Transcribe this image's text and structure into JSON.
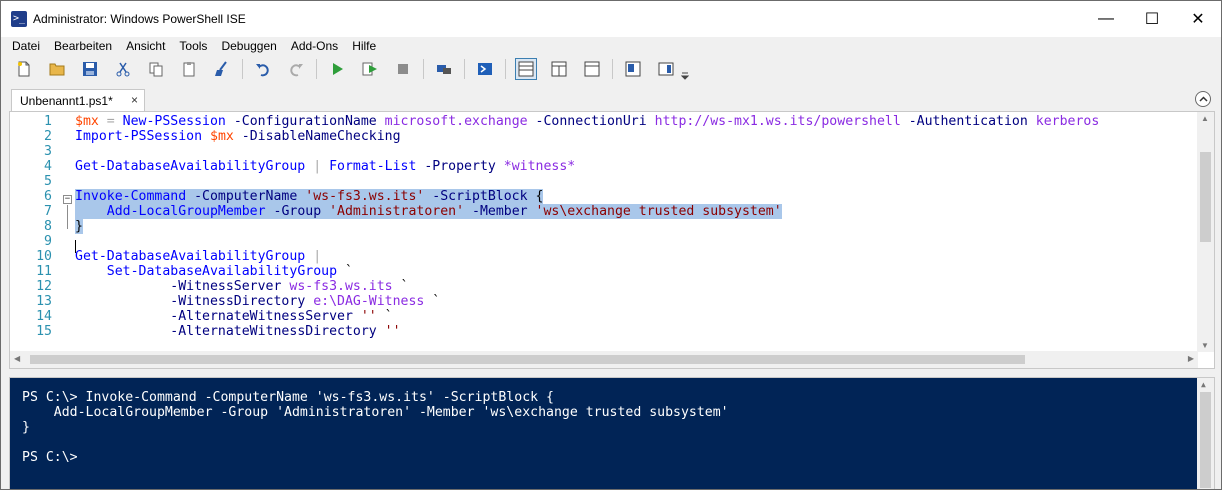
{
  "window": {
    "title": "Administrator: Windows PowerShell ISE",
    "app_icon_glyph": ">_",
    "controls": {
      "minimize": "—",
      "maximize": "☐",
      "close": "✕"
    }
  },
  "menu": [
    "Datei",
    "Bearbeiten",
    "Ansicht",
    "Tools",
    "Debuggen",
    "Add-Ons",
    "Hilfe"
  ],
  "toolbar": {
    "buttons": [
      "new-file",
      "open-file",
      "save",
      "cut",
      "copy",
      "paste",
      "clear-console",
      "undo",
      "redo",
      "run-script",
      "run-selection",
      "stop",
      "new-remote-tab",
      "start-powershell",
      "layout-top",
      "layout-right",
      "layout-max",
      "show-script-pane",
      "show-commands",
      "more"
    ],
    "active": "layout-top"
  },
  "tab": {
    "label": "Unbenannt1.ps1*",
    "close": "×"
  },
  "editor": {
    "lines": [
      {
        "n": "1",
        "tokens": [
          {
            "t": "$mx",
            "c": "var"
          },
          {
            "t": " = ",
            "c": "op"
          },
          {
            "t": "New-PSSession",
            "c": "cmd"
          },
          {
            "t": " -ConfigurationName ",
            "c": "param"
          },
          {
            "t": "microsoft.exchange",
            "c": "arg"
          },
          {
            "t": " -ConnectionUri ",
            "c": "param"
          },
          {
            "t": "http://ws-mx1.ws.its/powershell",
            "c": "arg"
          },
          {
            "t": " -Authentication ",
            "c": "param"
          },
          {
            "t": "kerberos",
            "c": "arg"
          }
        ]
      },
      {
        "n": "2",
        "tokens": [
          {
            "t": "Import-PSSession",
            "c": "cmd"
          },
          {
            "t": " ",
            "c": "grp"
          },
          {
            "t": "$mx",
            "c": "var"
          },
          {
            "t": " -DisableNameChecking",
            "c": "param"
          }
        ]
      },
      {
        "n": "3",
        "tokens": []
      },
      {
        "n": "4",
        "tokens": [
          {
            "t": "Get-DatabaseAvailabilityGroup",
            "c": "cmd"
          },
          {
            "t": " | ",
            "c": "op"
          },
          {
            "t": "Format-List",
            "c": "cmd"
          },
          {
            "t": " -Property ",
            "c": "param"
          },
          {
            "t": "*witness*",
            "c": "arg"
          }
        ]
      },
      {
        "n": "5",
        "tokens": []
      },
      {
        "n": "6",
        "tokens": [
          {
            "t": "Invoke-Command",
            "c": "cmd"
          },
          {
            "t": " -ComputerName ",
            "c": "param"
          },
          {
            "t": "'ws-fs3.ws.its'",
            "c": "str"
          },
          {
            "t": " -ScriptBlock ",
            "c": "param"
          },
          {
            "t": "{",
            "c": "grp"
          }
        ],
        "selected": true
      },
      {
        "n": "7",
        "tokens": [
          {
            "t": "    ",
            "c": "grp"
          },
          {
            "t": "Add-LocalGroupMember",
            "c": "cmd"
          },
          {
            "t": " -Group ",
            "c": "param"
          },
          {
            "t": "'Administratoren'",
            "c": "str"
          },
          {
            "t": " -Member ",
            "c": "param"
          },
          {
            "t": "'ws\\exchange trusted subsystem'",
            "c": "str"
          }
        ],
        "selected": true
      },
      {
        "n": "8",
        "tokens": [
          {
            "t": "}",
            "c": "grp"
          }
        ],
        "selected": true
      },
      {
        "n": "9",
        "tokens": []
      },
      {
        "n": "10",
        "tokens": [
          {
            "t": "Get-DatabaseAvailabilityGroup",
            "c": "cmd"
          },
          {
            "t": " |",
            "c": "op"
          }
        ]
      },
      {
        "n": "11",
        "tokens": [
          {
            "t": "    ",
            "c": "grp"
          },
          {
            "t": "Set-DatabaseAvailabilityGroup",
            "c": "cmd"
          },
          {
            "t": " `",
            "c": "grp"
          }
        ]
      },
      {
        "n": "12",
        "tokens": [
          {
            "t": "            ",
            "c": "grp"
          },
          {
            "t": "-WitnessServer ",
            "c": "param"
          },
          {
            "t": "ws-fs3.ws.its",
            "c": "arg"
          },
          {
            "t": " `",
            "c": "grp"
          }
        ]
      },
      {
        "n": "13",
        "tokens": [
          {
            "t": "            ",
            "c": "grp"
          },
          {
            "t": "-WitnessDirectory ",
            "c": "param"
          },
          {
            "t": "e:\\DAG-Witness",
            "c": "arg"
          },
          {
            "t": " `",
            "c": "grp"
          }
        ]
      },
      {
        "n": "14",
        "tokens": [
          {
            "t": "            ",
            "c": "grp"
          },
          {
            "t": "-AlternateWitnessServer ",
            "c": "param"
          },
          {
            "t": "''",
            "c": "str"
          },
          {
            "t": " `",
            "c": "grp"
          }
        ]
      },
      {
        "n": "15",
        "tokens": [
          {
            "t": "            ",
            "c": "grp"
          },
          {
            "t": "-AlternateWitnessDirectory ",
            "c": "param"
          },
          {
            "t": "''",
            "c": "str"
          }
        ]
      }
    ],
    "fold_glyph": "−"
  },
  "console": {
    "lines": [
      "PS C:\\> Invoke-Command -ComputerName 'ws-fs3.ws.its' -ScriptBlock {",
      "    Add-LocalGroupMember -Group 'Administratoren' -Member 'ws\\exchange trusted subsystem'",
      "}",
      "",
      "PS C:\\>"
    ]
  },
  "colors": {
    "console_bg": "#012456",
    "selection": "#a9c7ea",
    "line_numbers": "#2b91af",
    "variable": "#ff4500",
    "command": "#0000ff",
    "parameter": "#000080",
    "argument": "#8a2be2",
    "string": "#8b0000",
    "operator": "#a9a9a9"
  }
}
